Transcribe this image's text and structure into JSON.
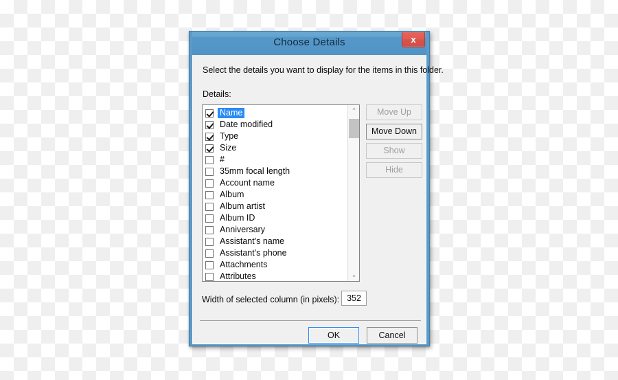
{
  "window": {
    "title": "Choose Details",
    "close_label": "x",
    "close_icon": "close-icon"
  },
  "dialog": {
    "instruction": "Select the details you want to display for the items in this folder.",
    "details_label": "Details:"
  },
  "details_list": {
    "items": [
      {
        "label": "Name",
        "checked": true,
        "selected": true
      },
      {
        "label": "Date modified",
        "checked": true,
        "selected": false
      },
      {
        "label": "Type",
        "checked": true,
        "selected": false
      },
      {
        "label": "Size",
        "checked": true,
        "selected": false
      },
      {
        "label": "#",
        "checked": false,
        "selected": false
      },
      {
        "label": "35mm focal length",
        "checked": false,
        "selected": false
      },
      {
        "label": "Account name",
        "checked": false,
        "selected": false
      },
      {
        "label": "Album",
        "checked": false,
        "selected": false
      },
      {
        "label": "Album artist",
        "checked": false,
        "selected": false
      },
      {
        "label": "Album ID",
        "checked": false,
        "selected": false
      },
      {
        "label": "Anniversary",
        "checked": false,
        "selected": false
      },
      {
        "label": "Assistant's name",
        "checked": false,
        "selected": false
      },
      {
        "label": "Assistant's phone",
        "checked": false,
        "selected": false
      },
      {
        "label": "Attachments",
        "checked": false,
        "selected": false
      },
      {
        "label": "Attributes",
        "checked": false,
        "selected": false
      },
      {
        "label": "",
        "checked": false,
        "selected": false
      }
    ]
  },
  "scrollbar": {
    "up_arrow": "⌃",
    "down_arrow": "⌄"
  },
  "side_buttons": [
    {
      "label": "Move Up",
      "enabled": false,
      "name": "move-up-button"
    },
    {
      "label": "Move Down",
      "enabled": true,
      "name": "move-down-button"
    },
    {
      "label": "Show",
      "enabled": false,
      "name": "show-button"
    },
    {
      "label": "Hide",
      "enabled": false,
      "name": "hide-button"
    }
  ],
  "width_row": {
    "label": "Width of selected column (in pixels):",
    "value": "352"
  },
  "footer": {
    "ok_label": "OK",
    "cancel_label": "Cancel"
  },
  "colors": {
    "titlebar": "#5a9bc9",
    "dialog_border": "#5a9bc9",
    "close_button": "#de5a51",
    "selection": "#2a8bf2",
    "client_bg": "#f0f0f0",
    "focus_border": "#2a8bf2"
  }
}
